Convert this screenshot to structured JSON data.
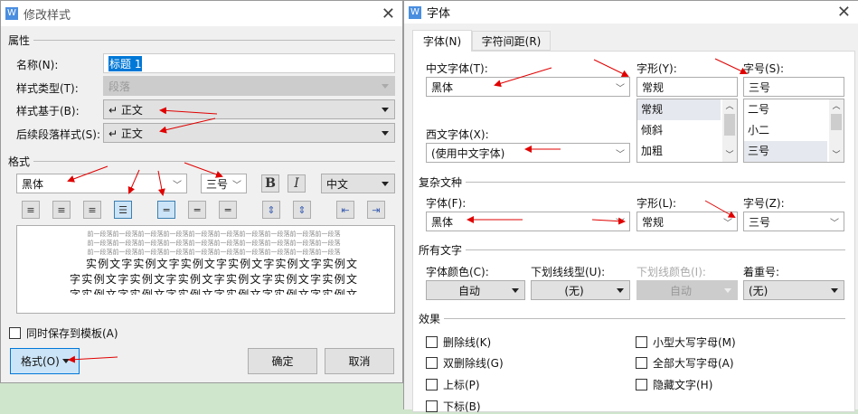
{
  "left": {
    "title": "修改样式",
    "close": "✕",
    "props_group": "属性",
    "name_label": "名称(N):",
    "name_value": "标题 1",
    "type_label": "样式类型(T):",
    "type_value": "段落",
    "based_label": "样式基于(B):",
    "based_value": "↵ 正文",
    "next_label": "后续段落样式(S):",
    "next_value": "↵ 正文",
    "format_group": "格式",
    "font": "黑体",
    "size": "三号",
    "bold": "B",
    "italic": "I",
    "lang": "中文",
    "preview_prev": "前一段落前一段落前一段落前一段落前一段落前一段落前一段落前一段落前一段落前一段落",
    "preview_sample": "实例文字实例文字实例文字实例文字实例文字实例文字实例文字实例文字实例文字实例文字实例文字实例文字实例文字实例文字实例文字实例文字实例文字实例文字",
    "save_template": "同时保存到模板(A)",
    "format_btn": "格式(O)",
    "ok": "确定",
    "cancel": "取消"
  },
  "right": {
    "title": "字体",
    "close": "✕",
    "tabs": [
      "字体(N)",
      "字符间距(R)"
    ],
    "cn_font_label": "中文字体(T):",
    "cn_font": "黑体",
    "style_label": "字形(Y):",
    "style_value": "常规",
    "style_list": [
      "常规",
      "倾斜",
      "加粗"
    ],
    "size_label": "字号(S):",
    "size_value": "三号",
    "size_list": [
      "二号",
      "小二",
      "三号"
    ],
    "west_label": "西文字体(X):",
    "west_font": "(使用中文字体)",
    "complex_group": "复杂文种",
    "cx_font_label": "字体(F):",
    "cx_font": "黑体",
    "cx_style_label": "字形(L):",
    "cx_style": "常规",
    "cx_size_label": "字号(Z):",
    "cx_size": "三号",
    "all_group": "所有文字",
    "color_label": "字体颜色(C):",
    "color": "自动",
    "ul_label": "下划线线型(U):",
    "ul": "(无)",
    "ulc_label": "下划线颜色(I):",
    "ulc": "自动",
    "em_label": "着重号:",
    "em": "(无)",
    "effects_group": "效果",
    "effects": [
      "删除线(K)",
      "双删除线(G)",
      "上标(P)",
      "下标(B)",
      "小型大写字母(M)",
      "全部大写字母(A)",
      "隐藏文字(H)"
    ]
  },
  "accent": "#e00000"
}
